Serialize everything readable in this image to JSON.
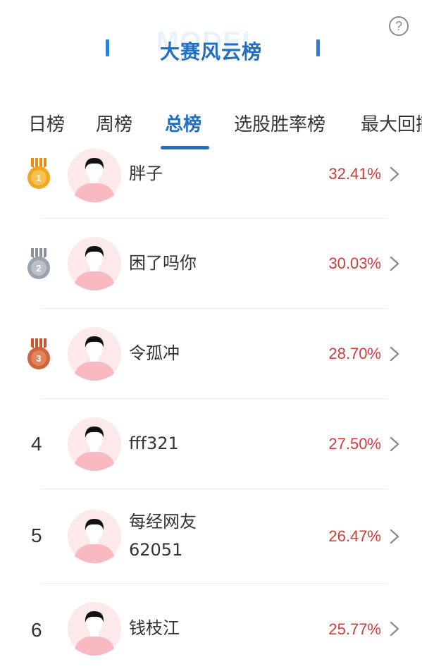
{
  "header": {
    "title": "大赛风云榜",
    "watermark": "MODEL",
    "help_icon": "?"
  },
  "tabs": [
    {
      "label": "日榜",
      "active": false
    },
    {
      "label": "周榜",
      "active": false
    },
    {
      "label": "总榜",
      "active": true
    },
    {
      "label": "选股胜率榜",
      "active": false
    },
    {
      "label": "最大回撤",
      "active": false
    }
  ],
  "colors": {
    "accent": "#1f6fc5",
    "percent": "#d23a3a",
    "gold": "#f0a020",
    "silver": "#9aa3ad",
    "bronze": "#d0643c"
  },
  "rows": [
    {
      "rank": "1",
      "medal": "gold-medal-icon",
      "name": "胖子",
      "name_line2": "",
      "percent": "32.41%"
    },
    {
      "rank": "2",
      "medal": "silver-medal-icon",
      "name": "困了吗你",
      "name_line2": "",
      "percent": "30.03%"
    },
    {
      "rank": "3",
      "medal": "bronze-medal-icon",
      "name": "令孤冲",
      "name_line2": "",
      "percent": "28.70%"
    },
    {
      "rank": "4",
      "medal": "",
      "name": "fff321",
      "name_line2": "",
      "percent": "27.50%"
    },
    {
      "rank": "5",
      "medal": "",
      "name": "每经网友",
      "name_line2": "62051",
      "percent": "26.47%"
    },
    {
      "rank": "6",
      "medal": "",
      "name": "钱枝江",
      "name_line2": "",
      "percent": "25.77%"
    }
  ]
}
